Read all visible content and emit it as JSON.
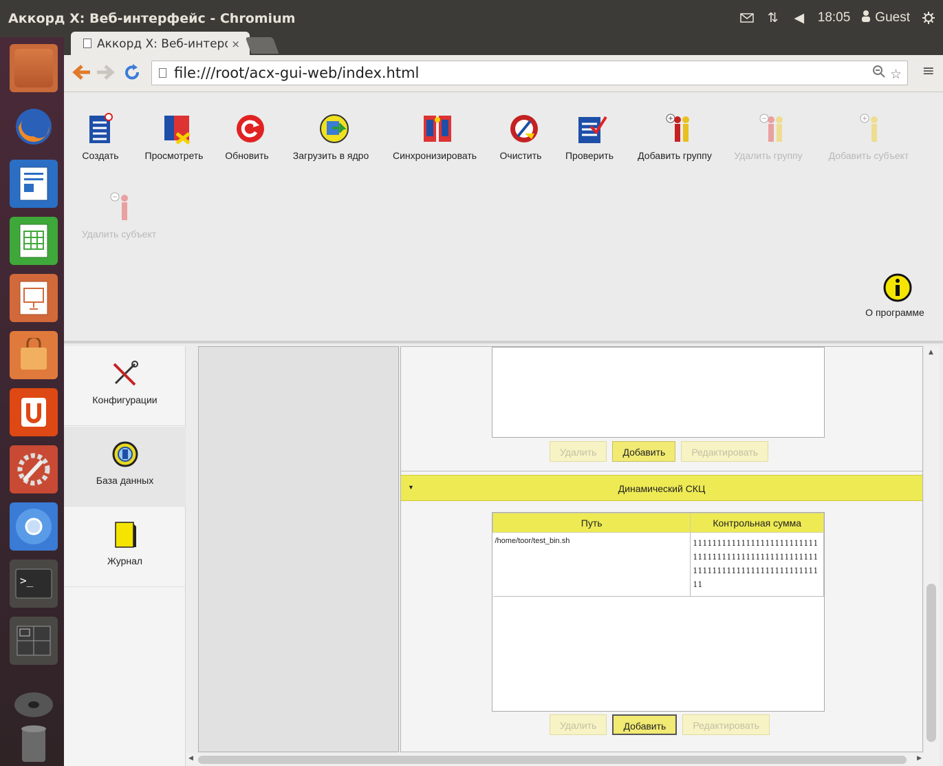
{
  "window": {
    "title": "Аккорд X: Веб-интерфейс - Chromium",
    "tray": {
      "time": "18:05",
      "user": "Guest"
    }
  },
  "browser": {
    "tab_label": "Аккорд X: Веб-интерфейс",
    "tab_close": "×",
    "url": "file:///root/acx-gui-web/index.html"
  },
  "ribbon": {
    "buttons": [
      {
        "label": "Создать",
        "enabled": true
      },
      {
        "label": "Просмотреть",
        "enabled": true
      },
      {
        "label": "Обновить",
        "enabled": true
      },
      {
        "label": "Загрузить в ядро",
        "enabled": true
      },
      {
        "label": "Синхронизировать",
        "enabled": true
      },
      {
        "label": "Очистить",
        "enabled": true
      },
      {
        "label": "Проверить",
        "enabled": true
      },
      {
        "label": "Добавить группу",
        "enabled": true
      },
      {
        "label": "Удалить группу",
        "enabled": false
      },
      {
        "label": "Добавить субъект",
        "enabled": false
      },
      {
        "label": "Удалить субъект",
        "enabled": false
      }
    ],
    "about_label": "О программе"
  },
  "leftnav": {
    "items": [
      {
        "label": "Конфигурации",
        "icon": "tools-icon"
      },
      {
        "label": "База данных",
        "icon": "database-icon"
      },
      {
        "label": "Журнал",
        "icon": "journal-icon"
      }
    ]
  },
  "content": {
    "top_buttons": {
      "delete": "Удалить",
      "add": "Добавить",
      "edit": "Редактировать"
    },
    "section": {
      "title": "Динамический СКЦ",
      "columns": [
        "Путь",
        "Контрольная сумма"
      ],
      "rows": [
        {
          "path": "/home/toor/test_bin.sh",
          "checksum": "11111111111111111111111111111111111111111111111111111111111111111111111111111111"
        }
      ],
      "buttons": {
        "delete": "Удалить",
        "add": "Добавить",
        "edit": "Редактировать"
      }
    }
  },
  "colors": {
    "accent_yellow": "#eeea54",
    "topbar": "#3c3b37"
  }
}
